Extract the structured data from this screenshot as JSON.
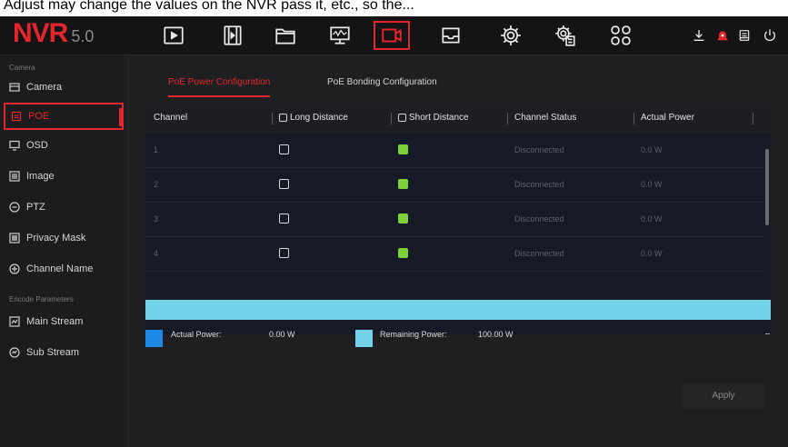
{
  "caption": "Adjust may change the values on the NVR pass it, etc., so the...",
  "app": {
    "logo": "NVR",
    "version": "5.0"
  },
  "topbar": {
    "icons": [
      "playback-icon",
      "video-clip-icon",
      "folder-icon",
      "monitor-icon",
      "camera-icon",
      "storage-icon",
      "gear-icon",
      "system-settings-icon",
      "apps-icon"
    ],
    "active": "camera-icon",
    "right_icons": [
      "download-icon",
      "alarm-icon",
      "backup-icon",
      "power-icon"
    ]
  },
  "sidebar": {
    "section_camera": "Camera",
    "items_camera": [
      {
        "label": "Camera",
        "icon": "camera-icon"
      },
      {
        "label": "POE",
        "icon": "poe-icon",
        "active": true
      },
      {
        "label": "OSD",
        "icon": "osd-icon"
      },
      {
        "label": "Image",
        "icon": "image-icon"
      },
      {
        "label": "PTZ",
        "icon": "ptz-icon"
      },
      {
        "label": "Privacy Mask",
        "icon": "privacy-mask-icon"
      },
      {
        "label": "Channel Name",
        "icon": "channel-name-icon"
      }
    ],
    "section_encode": "Encode Parameters",
    "items_encode": [
      {
        "label": "Main Stream",
        "icon": "main-stream-icon"
      },
      {
        "label": "Sub Stream",
        "icon": "sub-stream-icon"
      }
    ]
  },
  "tabs": [
    {
      "label": "PoE Power Configuration",
      "active": true
    },
    {
      "label": "PoE Bonding Configuration",
      "active": false
    }
  ],
  "table": {
    "headers": [
      "Channel",
      "Long Distance",
      "Short Distance",
      "Channel Status",
      "Actual Power"
    ],
    "rows": [
      {
        "channel": "1",
        "long_distance": false,
        "short_distance": true,
        "status": "Disconnected",
        "power": "0.0 W"
      },
      {
        "channel": "2",
        "long_distance": false,
        "short_distance": true,
        "status": "Disconnected",
        "power": "0.0 W"
      },
      {
        "channel": "3",
        "long_distance": false,
        "short_distance": true,
        "status": "Disconnected",
        "power": "0.0 W"
      },
      {
        "channel": "4",
        "long_distance": false,
        "short_distance": true,
        "status": "Disconnected",
        "power": "0.0 W"
      }
    ]
  },
  "power": {
    "actual_label": "Actual Power:",
    "actual_value": "0.00 W",
    "remaining_label": "Remaining Power:",
    "remaining_value": "100.00 W",
    "actual_fraction": 0.0,
    "actual_color": "#1e88e5",
    "remaining_color": "#74d2ea"
  },
  "buttons": {
    "apply": "Apply"
  },
  "colors": {
    "accent": "#e3262b",
    "green": "#7ed13a"
  }
}
